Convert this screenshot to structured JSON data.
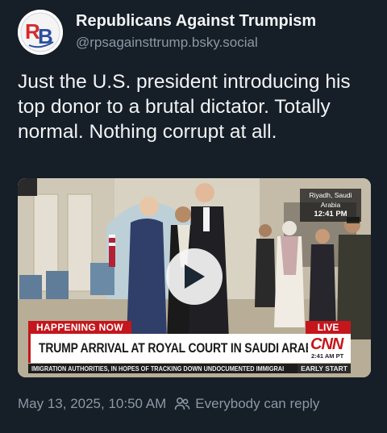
{
  "author": {
    "display_name": "Republicans Against Trumpism",
    "handle": "@rpsagainsttrump.bsky.social",
    "avatar_letters": "RB"
  },
  "post": {
    "text": "Just the U.S. president introducing his top donor to a brutal dictator. Totally normal. Nothing corrupt at all."
  },
  "video": {
    "location": "Riyadh, Saudi Arabia",
    "time": "12:41 PM",
    "happening_now": "HAPPENING NOW",
    "live": "LIVE",
    "headline": "TRUMP ARRIVAL AT ROYAL COURT IN SAUDI ARABIA",
    "network": "CNN",
    "network_time": "2:41 AM PT",
    "ticker": "IMIGRATION AUTHORITIES, IN HOPES OF TRACKING DOWN UNDOCUMENTED IMMIGRAI",
    "ticker_tag": "EARLY START",
    "play_icon": "play-icon"
  },
  "footer": {
    "timestamp": "May 13, 2025, 10:50 AM",
    "reply_setting": "Everybody can reply",
    "reply_icon": "people-icon"
  },
  "colors": {
    "background": "#161e27",
    "text": "#f1f3f5",
    "muted": "#8b98a5",
    "cnn_red": "#c4161c"
  }
}
